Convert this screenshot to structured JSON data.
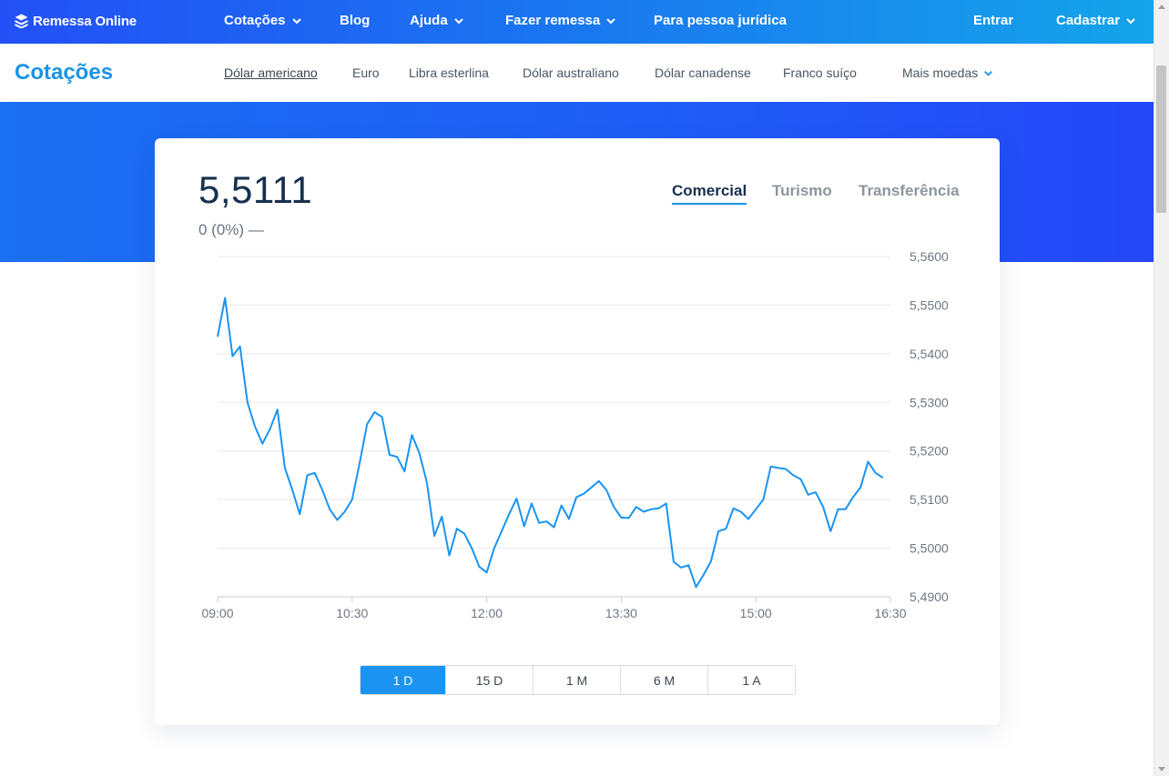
{
  "topnav": {
    "logo_text": "Remessa Online",
    "items": [
      {
        "label": "Cotações",
        "has_dropdown": true
      },
      {
        "label": "Blog",
        "has_dropdown": false
      },
      {
        "label": "Ajuda",
        "has_dropdown": true
      },
      {
        "label": "Fazer remessa",
        "has_dropdown": true
      },
      {
        "label": "Para pessoa jurídica",
        "has_dropdown": false
      }
    ],
    "login_label": "Entrar",
    "signup_label": "Cadastrar"
  },
  "subnav": {
    "title": "Cotações",
    "currencies": [
      "Dólar americano",
      "Euro",
      "Libra esterlina",
      "Dólar australiano",
      "Dólar canadense",
      "Franco suíço"
    ],
    "active_currency": "Dólar americano",
    "more_label": "Mais moedas"
  },
  "quote": {
    "rate": "5,5111",
    "change": "0 (0%)",
    "change_indicator": "—",
    "tabs": [
      "Comercial",
      "Turismo",
      "Transferência"
    ],
    "active_tab": "Comercial"
  },
  "periods": {
    "options": [
      "1 D",
      "15 D",
      "1 M",
      "6 M",
      "1 A"
    ],
    "active": "1 D"
  },
  "colors": {
    "accent": "#1a94e6",
    "line": "#1a94f0",
    "rate_text": "#17304f"
  },
  "chart_data": {
    "type": "line",
    "title": "",
    "xlabel": "",
    "ylabel": "",
    "ylim": [
      5.49,
      5.56
    ],
    "xlim": [
      "09:00",
      "16:30"
    ],
    "x_ticks": [
      "09:00",
      "10:30",
      "12:00",
      "13:30",
      "15:00",
      "16:30"
    ],
    "y_ticks": [
      "5,4900",
      "5,5000",
      "5,5100",
      "5,5200",
      "5,5300",
      "5,5400",
      "5,5500",
      "5,5600"
    ],
    "y_tick_values": [
      5.49,
      5.5,
      5.51,
      5.52,
      5.53,
      5.54,
      5.55,
      5.56
    ],
    "grid": true,
    "series": [
      {
        "x": [
          "09:00",
          "09:05",
          "09:10",
          "09:15",
          "09:20",
          "09:25",
          "09:30",
          "09:35",
          "09:40",
          "09:45",
          "09:50",
          "09:55",
          "10:00",
          "10:05",
          "10:10",
          "10:15",
          "10:20",
          "10:25",
          "10:30",
          "10:35",
          "10:40",
          "10:45",
          "10:50",
          "10:55",
          "11:00",
          "11:05",
          "11:10",
          "11:15",
          "11:20",
          "11:25",
          "11:30",
          "11:35",
          "11:40",
          "11:45",
          "11:50",
          "11:55",
          "12:00",
          "12:05",
          "12:10",
          "12:15",
          "12:20",
          "12:25",
          "12:30",
          "12:35",
          "12:40",
          "12:45",
          "12:50",
          "12:55",
          "13:00",
          "13:05",
          "13:10",
          "13:15",
          "13:20",
          "13:25",
          "13:30",
          "13:35",
          "13:40",
          "13:45",
          "13:50",
          "13:55",
          "14:00",
          "14:05",
          "14:10",
          "14:15",
          "14:20",
          "14:25",
          "14:30",
          "14:35",
          "14:40",
          "14:45",
          "14:50",
          "14:55",
          "15:00",
          "15:05",
          "15:10",
          "15:15",
          "15:20",
          "15:25",
          "15:30",
          "15:35",
          "15:40",
          "15:45",
          "15:50",
          "15:55",
          "16:00",
          "16:05",
          "16:10",
          "16:15",
          "16:20",
          "16:25"
        ],
        "values": [
          5.5435,
          5.5515,
          5.5395,
          5.5415,
          5.53,
          5.525,
          5.5215,
          5.5245,
          5.5285,
          5.5165,
          5.512,
          5.507,
          5.515,
          5.5155,
          5.512,
          5.508,
          5.5058,
          5.5075,
          5.51,
          5.5175,
          5.5255,
          5.528,
          5.527,
          5.5192,
          5.5188,
          5.5158,
          5.5233,
          5.5195,
          5.5135,
          5.5025,
          5.5065,
          5.4985,
          5.504,
          5.503,
          5.5,
          5.4962,
          5.495,
          5.5,
          5.5035,
          5.507,
          5.5102,
          5.5045,
          5.5092,
          5.5052,
          5.5055,
          5.5043,
          5.5088,
          5.506,
          5.5105,
          5.5112,
          5.5125,
          5.5138,
          5.512,
          5.5085,
          5.5063,
          5.5062,
          5.5085,
          5.5075,
          5.508,
          5.5082,
          5.5092,
          5.4972,
          5.496,
          5.4965,
          5.492,
          5.4945,
          5.4973,
          5.5035,
          5.504,
          5.5082,
          5.5075,
          5.506,
          5.508,
          5.51,
          5.5168,
          5.5165,
          5.5163,
          5.515,
          5.5142,
          5.511,
          5.5115,
          5.5085,
          5.5035,
          5.508,
          5.508,
          5.5105,
          5.5125,
          5.5178,
          5.5155,
          5.5145
        ]
      }
    ],
    "last_value": 5.5111
  }
}
